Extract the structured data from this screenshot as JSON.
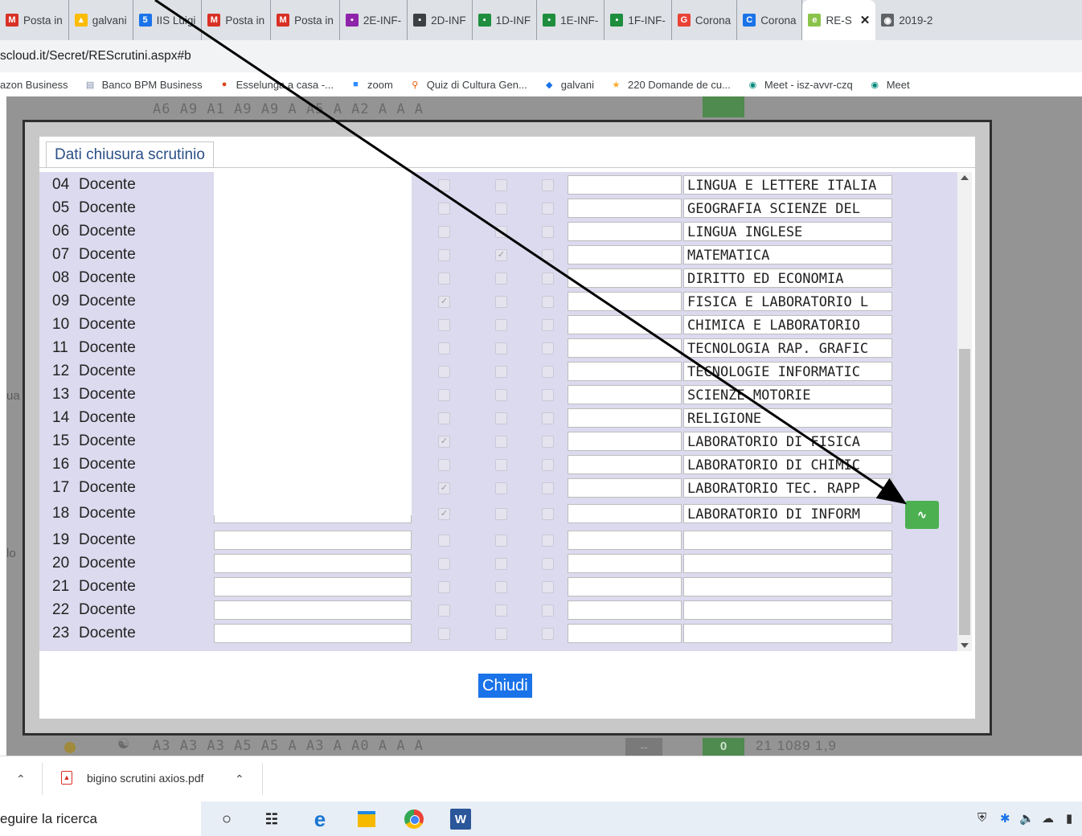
{
  "tabs": [
    {
      "label": "Posta in",
      "icon": "gmail-icon",
      "color": "#d93025",
      "glyph": "M"
    },
    {
      "label": "galvani",
      "icon": "google-drive-icon",
      "color": "#fbbc04",
      "glyph": "▲"
    },
    {
      "label": "IIS Luigi",
      "icon": "calendar-icon",
      "color": "#1a73e8",
      "glyph": "5"
    },
    {
      "label": "Posta in",
      "icon": "gmail-icon",
      "color": "#d93025",
      "glyph": "M"
    },
    {
      "label": "Posta in",
      "icon": "gmail-icon",
      "color": "#d93025",
      "glyph": "M"
    },
    {
      "label": "2E-INF-",
      "icon": "classroom-icon",
      "color": "#8e24aa",
      "glyph": "▪"
    },
    {
      "label": "2D-INF",
      "icon": "classroom-icon",
      "color": "#3c4043",
      "glyph": "▪"
    },
    {
      "label": "1D-INF",
      "icon": "classroom-icon",
      "color": "#1e8e3e",
      "glyph": "▪"
    },
    {
      "label": "1E-INF-",
      "icon": "classroom-icon",
      "color": "#1e8e3e",
      "glyph": "▪"
    },
    {
      "label": "1F-INF-",
      "icon": "classroom-icon",
      "color": "#1e8e3e",
      "glyph": "▪"
    },
    {
      "label": "Corona",
      "icon": "google-icon",
      "color": "#ea4335",
      "glyph": "G"
    },
    {
      "label": "Corona",
      "icon": "blog-icon",
      "color": "#1a73e8",
      "glyph": "C"
    },
    {
      "label": "RE-S",
      "icon": "axios-icon",
      "color": "#8bc34a",
      "glyph": "e",
      "active": true
    },
    {
      "label": "2019-2",
      "icon": "globe-icon",
      "color": "#5f6368",
      "glyph": "◉"
    }
  ],
  "address": "scloud.it/Secret/REScrutini.aspx#b",
  "bookmarks": [
    {
      "label": "azon Business",
      "icon": ""
    },
    {
      "label": "Banco BPM Business",
      "icon": "document-icon"
    },
    {
      "label": "Esselunga a casa -...",
      "icon": "esselunga-icon"
    },
    {
      "label": "zoom",
      "icon": "zoom-icon"
    },
    {
      "label": "Quiz di Cultura Gen...",
      "icon": "quiz-icon"
    },
    {
      "label": "galvani",
      "icon": "galvani-icon"
    },
    {
      "label": "220 Domande de cu...",
      "icon": "star-icon"
    },
    {
      "label": "Meet - isz-avvr-czq",
      "icon": "meet-icon"
    },
    {
      "label": "Meet",
      "icon": "meet-icon"
    }
  ],
  "background": {
    "top_row": "A6 A9 A1 A9 A9  A A5  A A2  A  A  A",
    "bottom_row": "A3 A3 A3 A5 A5  A A3  A A0  A  A  A",
    "bottom_dark": "--",
    "bottom_green": "0",
    "bottom_stats": "21  1089  1,9",
    "fragment_1": "ua",
    "fragment_2": "lo"
  },
  "modal": {
    "tab_label": "Dati chiusura scrutinio",
    "close_button": "Chiudi",
    "action_button_icon": "activity-icon",
    "rows": [
      {
        "num": "04",
        "label": "Docente",
        "checks": [
          false,
          false,
          false
        ],
        "subject": "LINGUA E LETTERE ITALIA"
      },
      {
        "num": "05",
        "label": "Docente",
        "checks": [
          false,
          false,
          false
        ],
        "subject": "GEOGRAFIA SCIENZE DEL"
      },
      {
        "num": "06",
        "label": "Docente",
        "checks": [
          false,
          false,
          false
        ],
        "subject": "LINGUA INGLESE"
      },
      {
        "num": "07",
        "label": "Docente",
        "checks": [
          false,
          true,
          false
        ],
        "subject": "MATEMATICA"
      },
      {
        "num": "08",
        "label": "Docente",
        "checks": [
          false,
          false,
          false
        ],
        "subject": "DIRITTO ED ECONOMIA"
      },
      {
        "num": "09",
        "label": "Docente",
        "checks": [
          true,
          false,
          false
        ],
        "subject": "FISICA E LABORATORIO L"
      },
      {
        "num": "10",
        "label": "Docente",
        "checks": [
          false,
          false,
          false
        ],
        "subject": "CHIMICA E LABORATORIO"
      },
      {
        "num": "11",
        "label": "Docente",
        "checks": [
          false,
          false,
          false
        ],
        "subject": "TECNOLOGIA RAP. GRAFIC"
      },
      {
        "num": "12",
        "label": "Docente",
        "checks": [
          false,
          false,
          false
        ],
        "subject": "TECNOLOGIE INFORMATIC"
      },
      {
        "num": "13",
        "label": "Docente",
        "checks": [
          false,
          false,
          false
        ],
        "subject": "SCIENZE MOTORIE"
      },
      {
        "num": "14",
        "label": "Docente",
        "checks": [
          false,
          false,
          false
        ],
        "subject": "RELIGIONE"
      },
      {
        "num": "15",
        "label": "Docente",
        "checks": [
          true,
          false,
          false
        ],
        "subject": "LABORATORIO DI FISICA"
      },
      {
        "num": "16",
        "label": "Docente",
        "checks": [
          false,
          false,
          false
        ],
        "subject": "LABORATORIO DI CHIMIC"
      },
      {
        "num": "17",
        "label": "Docente",
        "checks": [
          true,
          false,
          false
        ],
        "subject": "LABORATORIO TEC. RAPP"
      },
      {
        "num": "18",
        "label": "Docente",
        "checks": [
          true,
          false,
          false
        ],
        "subject": "LABORATORIO DI INFORM"
      },
      {
        "num": "19",
        "label": "Docente",
        "checks": [
          false,
          false,
          false
        ],
        "subject": ""
      },
      {
        "num": "20",
        "label": "Docente",
        "checks": [
          false,
          false,
          false
        ],
        "subject": ""
      },
      {
        "num": "21",
        "label": "Docente",
        "checks": [
          false,
          false,
          false
        ],
        "subject": ""
      },
      {
        "num": "22",
        "label": "Docente",
        "checks": [
          false,
          false,
          false
        ],
        "subject": ""
      },
      {
        "num": "23",
        "label": "Docente",
        "checks": [
          false,
          false,
          false
        ],
        "subject": ""
      }
    ]
  },
  "download": {
    "filename": "bigino scrutini axios.pdf"
  },
  "taskbar": {
    "search_text": "eguire la ricerca",
    "icons": [
      "cortana-icon",
      "task-view-icon",
      "edge-icon",
      "file-explorer-icon",
      "chrome-icon",
      "word-icon"
    ]
  },
  "colors": {
    "accent_blue": "#1a73e8",
    "green_button": "#4caf50",
    "modal_row_bg": "#dcdaee"
  }
}
